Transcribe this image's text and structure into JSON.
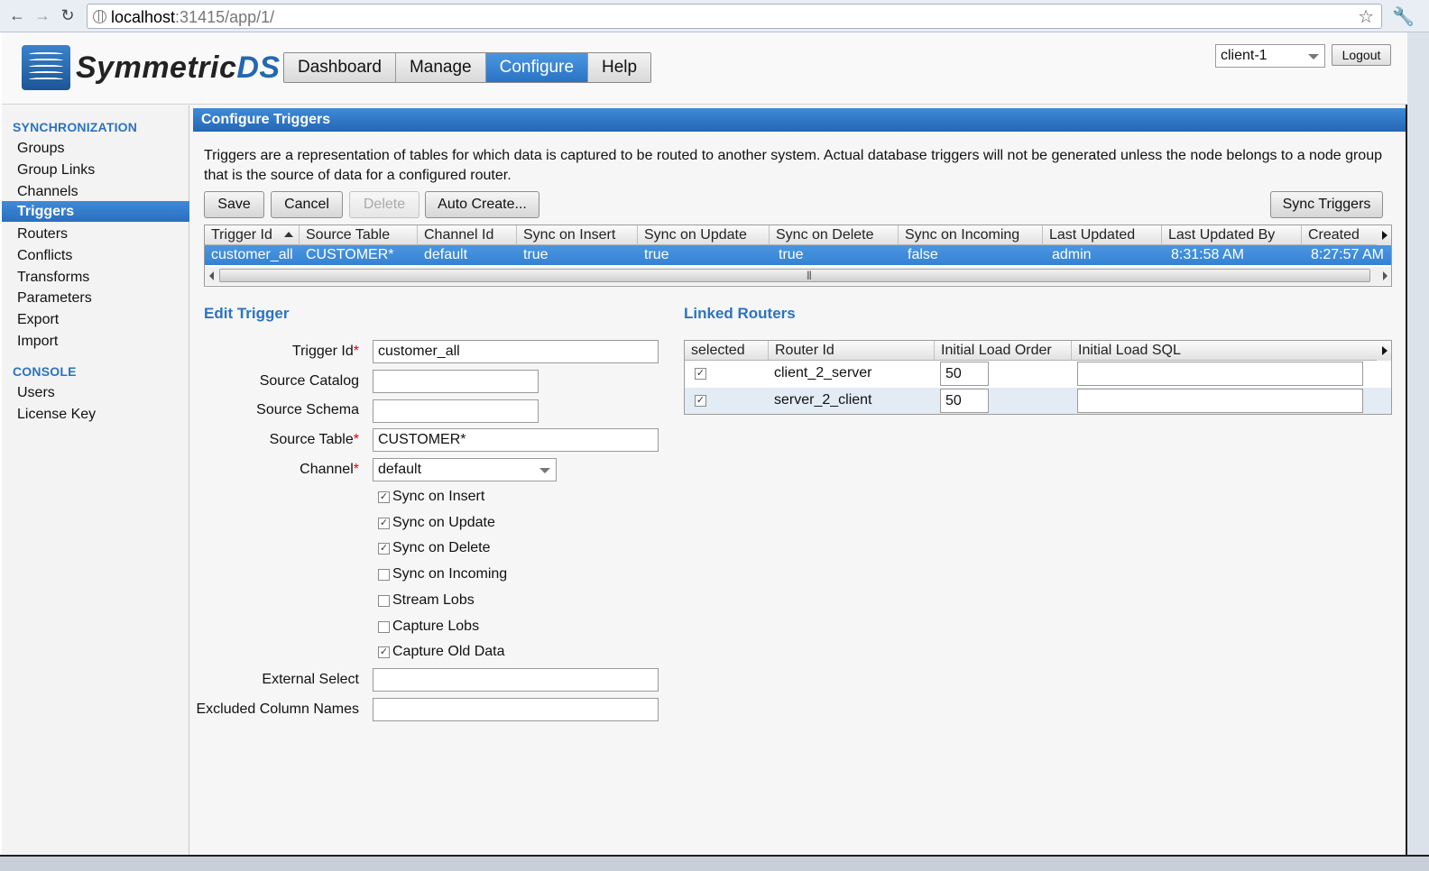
{
  "browser": {
    "url_host": "localhost",
    "url_rest": ":31415/app/1/"
  },
  "app": {
    "logo_text_a": "Symmetric",
    "logo_text_b": "DS",
    "nav": [
      "Dashboard",
      "Manage",
      "Configure",
      "Help"
    ],
    "nav_active": "Configure",
    "node_selected": "client-1",
    "logout_label": "Logout"
  },
  "sidebar": {
    "sections": [
      {
        "title": "SYNCHRONIZATION",
        "items": [
          "Groups",
          "Group Links",
          "Channels",
          "Triggers",
          "Routers",
          "Conflicts",
          "Transforms",
          "Parameters",
          "Export",
          "Import"
        ]
      },
      {
        "title": "CONSOLE",
        "items": [
          "Users",
          "License Key"
        ]
      }
    ],
    "active_item": "Triggers"
  },
  "panel": {
    "title": "Configure Triggers",
    "description": "Triggers are a representation of tables for which data is captured to be routed to another system. Actual database triggers will not be generated unless the node belongs to a node group that is the source of data for a configured router."
  },
  "toolbar": {
    "save": "Save",
    "cancel": "Cancel",
    "delete": "Delete",
    "auto_create": "Auto Create...",
    "sync_triggers": "Sync Triggers"
  },
  "triggers_table": {
    "columns": [
      "Trigger Id",
      "Source Table",
      "Channel Id",
      "Sync on Insert",
      "Sync on Update",
      "Sync on Delete",
      "Sync on Incoming",
      "Last Updated",
      "Last Updated By",
      "Created"
    ],
    "rows": [
      [
        "customer_all",
        "CUSTOMER*",
        "default",
        "true",
        "true",
        "true",
        "false",
        "admin",
        "8:31:58 AM",
        "8:27:57 AM"
      ]
    ]
  },
  "edit_trigger": {
    "title": "Edit Trigger",
    "labels": {
      "trigger_id": "Trigger Id",
      "source_catalog": "Source Catalog",
      "source_schema": "Source Schema",
      "source_table": "Source Table",
      "channel": "Channel",
      "external_select": "External Select",
      "excluded_columns": "Excluded Column Names"
    },
    "required_mark": "*",
    "values": {
      "trigger_id": "customer_all",
      "source_catalog": "",
      "source_schema": "",
      "source_table": "CUSTOMER*",
      "channel": "default",
      "external_select": "",
      "excluded_columns": ""
    },
    "checkboxes": [
      {
        "label": "Sync on Insert",
        "checked": true
      },
      {
        "label": "Sync on Update",
        "checked": true
      },
      {
        "label": "Sync on Delete",
        "checked": true
      },
      {
        "label": "Sync on Incoming",
        "checked": false
      },
      {
        "label": "Stream Lobs",
        "checked": false
      },
      {
        "label": "Capture Lobs",
        "checked": false
      },
      {
        "label": "Capture Old Data",
        "checked": true
      }
    ]
  },
  "linked_routers": {
    "title": "Linked Routers",
    "columns": [
      "selected",
      "Router Id",
      "Initial Load Order",
      "Initial Load SQL"
    ],
    "rows": [
      {
        "selected": true,
        "router_id": "client_2_server",
        "load_order": "50",
        "load_sql": ""
      },
      {
        "selected": true,
        "router_id": "server_2_client",
        "load_order": "50",
        "load_sql": ""
      }
    ]
  },
  "check_glyph": "✓",
  "colors": {
    "accent": "#2b73c1",
    "selected_row": "#3a86d6"
  }
}
